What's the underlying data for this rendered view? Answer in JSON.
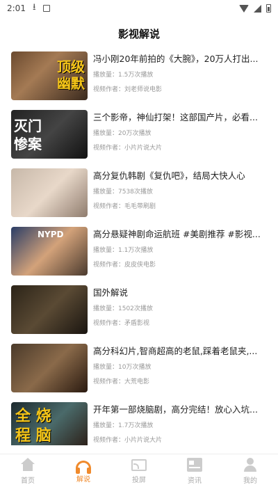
{
  "status_bar": {
    "time": "2:01"
  },
  "header": {
    "title": "影视解说"
  },
  "videos": [
    {
      "title": "冯小刚20年前拍的《大腕》，20万人打出...",
      "views": "播放量：1.5万次播放",
      "author": "视频作者：刘老师说电影",
      "thumb_caption": "顶级\n幽默"
    },
    {
      "title": "三个影帝，神仙打架！这部国产片，必看...",
      "views": "播放量：20万次播放",
      "author": "视频作者：小片片说大片",
      "thumb_caption": "灭门\n惨案"
    },
    {
      "title": "高分复仇韩剧《复仇吧》，结局大快人心",
      "views": "播放量：7538次播放",
      "author": "视频作者：毛毛带刷剧",
      "thumb_caption": ""
    },
    {
      "title": "高分悬疑神剧命运航班 #美剧推荐 #影视...",
      "views": "播放量：1.1万次播放",
      "author": "视频作者：皮皮侠电影",
      "thumb_caption": "NYPD"
    },
    {
      "title": "国外解说",
      "views": "播放量：1502次播放",
      "author": "视频作者：矛盾影视",
      "thumb_caption": ""
    },
    {
      "title": "高分科幻片,智商超高的老鼠,踩着老鼠夹,...",
      "views": "播放量：10万次播放",
      "author": "视频作者：大荒电影",
      "thumb_caption": ""
    },
    {
      "title": "开年第一部烧脑剧，高分完结！放心入坑...",
      "views": "播放量：1.7万次播放",
      "author": "视频作者：小片片说大片",
      "thumb_caption": "全 烧\n程 脑"
    }
  ],
  "tabbar": {
    "tabs": [
      {
        "label": "首页",
        "icon": "home-icon",
        "active": false
      },
      {
        "label": "解说",
        "icon": "headphone-icon",
        "active": true
      },
      {
        "label": "投屏",
        "icon": "cast-icon",
        "active": false
      },
      {
        "label": "资讯",
        "icon": "news-icon",
        "active": false
      },
      {
        "label": "我的",
        "icon": "user-icon",
        "active": false
      }
    ]
  },
  "colors": {
    "accent": "#f08a2c",
    "inactive": "#aaaaaa"
  }
}
